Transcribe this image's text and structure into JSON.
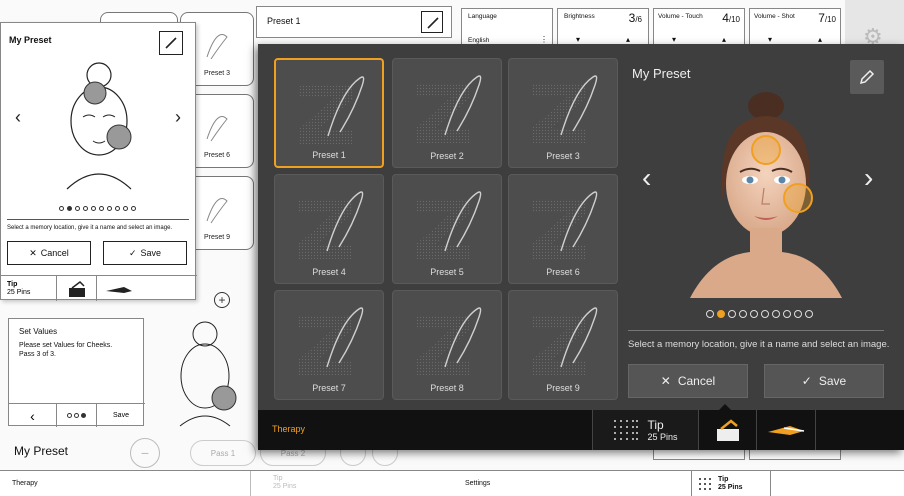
{
  "left_screen": {
    "dialog_title": "My Preset",
    "dots_total": 10,
    "dots_active": 1,
    "hint": "Select a memory location, give it a name and select an image.",
    "cancel_label": "Cancel",
    "save_label": "Save",
    "tip_label": "Tip",
    "tip_pins": "25 Pins",
    "header_title": "Preset 1",
    "tiles": [
      {
        "label": "Preset 3"
      },
      {
        "label": "Preset 6"
      },
      {
        "label": "Preset 9"
      }
    ],
    "set_values": {
      "title": "Set Values",
      "text": "Please set Values for Cheeks. Pass 3 of 3.",
      "save_label": "Save"
    },
    "pass_1": "Pass 1",
    "pass_2": "Pass 2",
    "bottom_title": "My Preset",
    "footer_therapy": "Therapy",
    "footer_tip": "Tip",
    "footer_pins": "25 Pins"
  },
  "right_screen": {
    "settings": [
      {
        "label": "Language",
        "value": "English"
      },
      {
        "label": "Brightness",
        "value": "3",
        "max": "/6"
      },
      {
        "label": "Volume - Touch",
        "value": "4",
        "max": "/10"
      },
      {
        "label": "Volume - Shot",
        "value": "7",
        "max": "/10"
      }
    ],
    "footer_settings": "Settings",
    "footer_tip": "Tip",
    "footer_pins": "25 Pins"
  },
  "main_dialog": {
    "presets": [
      {
        "label": "Preset 1",
        "selected": true
      },
      {
        "label": "Preset 2",
        "selected": false
      },
      {
        "label": "Preset 3",
        "selected": false
      },
      {
        "label": "Preset 4",
        "selected": false
      },
      {
        "label": "Preset 5",
        "selected": false
      },
      {
        "label": "Preset 6",
        "selected": false
      },
      {
        "label": "Preset 7",
        "selected": false
      },
      {
        "label": "Preset 8",
        "selected": false
      },
      {
        "label": "Preset 9",
        "selected": false
      }
    ],
    "title": "My Preset",
    "dots_total": 10,
    "dots_active": 1,
    "hint": "Select a memory location, give it a name and select an image.",
    "cancel_label": "Cancel",
    "save_label": "Save",
    "footer_therapy": "Therapy",
    "tip_label": "Tip",
    "tip_pins": "25 Pins",
    "colors": {
      "accent": "#f0a020",
      "panel": "#3e3e3e",
      "tile": "#4d4d4d",
      "footer": "#111111"
    },
    "icons": [
      "edit-pencil-icon",
      "chevron-left-icon",
      "chevron-right-icon",
      "close-icon",
      "check-icon",
      "grid-dots-icon",
      "applicator-tip-icon",
      "handpiece-icon"
    ]
  }
}
